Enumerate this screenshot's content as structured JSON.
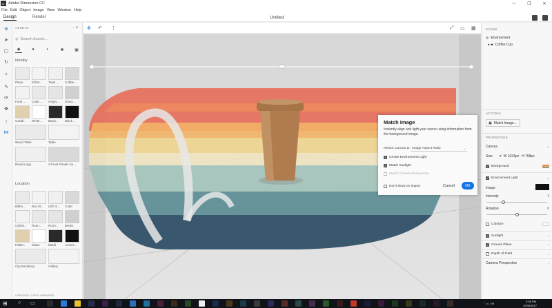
{
  "app": {
    "title": "Adobe Dimension CC",
    "menu": [
      "File",
      "Edit",
      "Object",
      "Image",
      "View",
      "Window",
      "Help"
    ],
    "tabs": [
      "Design",
      "Render"
    ],
    "document_title": "Untitled"
  },
  "assets_panel": {
    "header": "ASSETS",
    "search_placeholder": "Search Assets...",
    "identity_title": "Identity",
    "identity_items": [
      "Plane",
      "Gift B...",
      "Twist ...",
      "Coffee...",
      "Food ...",
      "Cube ...",
      "Origin...",
      "Gloss...",
      "Cardb...",
      "White...",
      "Black...",
      "Black ...",
      "Wood Table",
      "Table",
      "Brand Logo",
      "2-Front Panels Su..."
    ],
    "location_title": "Location",
    "location_items": [
      "Billbo...",
      "Bus St...",
      "LED S...",
      "Cube",
      "Cylind...",
      "Roun...",
      "Roun...",
      "Bricks",
      "Patter...",
      "Glass",
      "Metal",
      "Americ...",
      "City Backdrop",
      "Gallery"
    ],
    "footer": "CREATIVE CLOUD LIBRARIES"
  },
  "dialog": {
    "title": "Match Image",
    "description": "Instantly align and light your scene using information from the background image.",
    "resize_label": "Resize Canvas to",
    "resize_value": "Image Aspect Ratio",
    "create_env_light": "Create Environment Light",
    "match_sunlight": "Match Sunlight",
    "match_camera": "Match Camera Perspective",
    "dont_show": "Don't show on import",
    "cancel": "Cancel",
    "ok": "OK"
  },
  "right_panel": {
    "scene_header": "SCENE",
    "scene_items": [
      "Environment",
      "Coffee Cup"
    ],
    "actions_header": "ACTIONS",
    "match_image_button": "Match Image...",
    "properties_header": "PROPERTIES",
    "canvas_label": "Canvas",
    "size_label": "Size",
    "width_value": "W 1024px",
    "height_value": "H 768px",
    "background_label": "Background",
    "env_light_label": "Environment Light",
    "image_label": "Image",
    "intensity_label": "Intensity",
    "intensity_value": "1",
    "rotation_label": "Rotation",
    "rotation_value": "0",
    "colorize_label": "Colorize",
    "sunlight_label": "Sunlight",
    "ground_plane_label": "Ground Plane",
    "dof_label": "Depth of Field",
    "camera_persp_label": "Camera Perspective"
  },
  "taskbar": {
    "time": "3:38 PM",
    "date": "10/30/2017"
  },
  "colors": {
    "accent": "#1473e6",
    "tool_blue": "#2d7fd8",
    "taskbar": "#101418"
  }
}
